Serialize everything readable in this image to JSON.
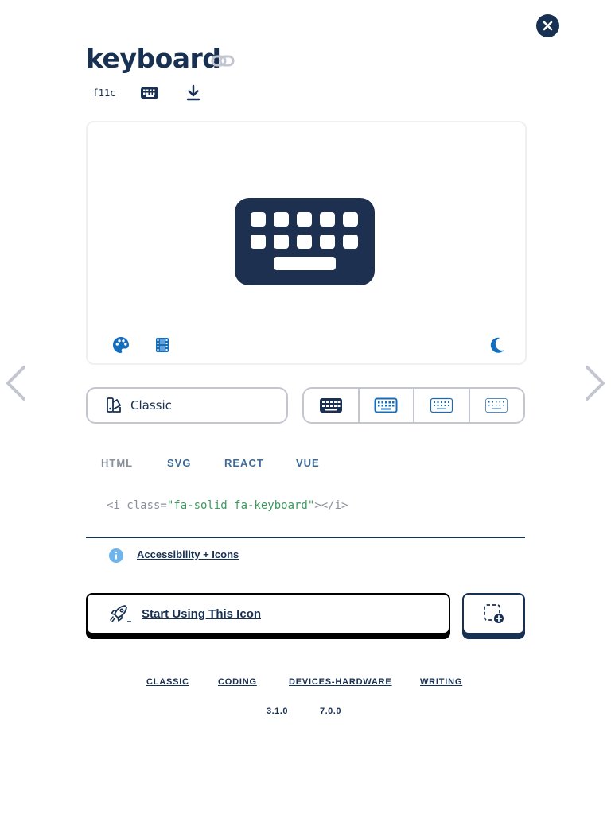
{
  "icon": {
    "name": "keyboard",
    "unicode": "f11c",
    "colors": {
      "primary": "#183153",
      "accent": "#146ebe",
      "border": "#c3c6d1",
      "code_string": "#3c9a5f",
      "tab_inactive": "#8a8f9c"
    }
  },
  "header_actions": {
    "link_icon": "link-icon",
    "glyph_icon": "keyboard-icon",
    "download_icon": "download-icon",
    "close_icon": "close-icon"
  },
  "preview_tools": [
    "palette-icon",
    "film-icon",
    "moon-icon"
  ],
  "family_select": {
    "label": "Classic",
    "icon": "style-swatch-icon"
  },
  "style_options": [
    "solid",
    "regular",
    "light",
    "thin"
  ],
  "code_tabs": [
    "HTML",
    "SVG",
    "REACT",
    "VUE"
  ],
  "code": {
    "prefix": "<i class=",
    "value": "\"fa-solid fa-keyboard\"",
    "suffix": "></i>"
  },
  "accessibility_link": "Accessibility + Icons",
  "start_button": "Start Using This Icon",
  "categories": [
    "CLASSIC",
    "CODING",
    "DEVICES-HARDWARE",
    "WRITING"
  ],
  "versions": [
    "3.1.0",
    "7.0.0"
  ]
}
